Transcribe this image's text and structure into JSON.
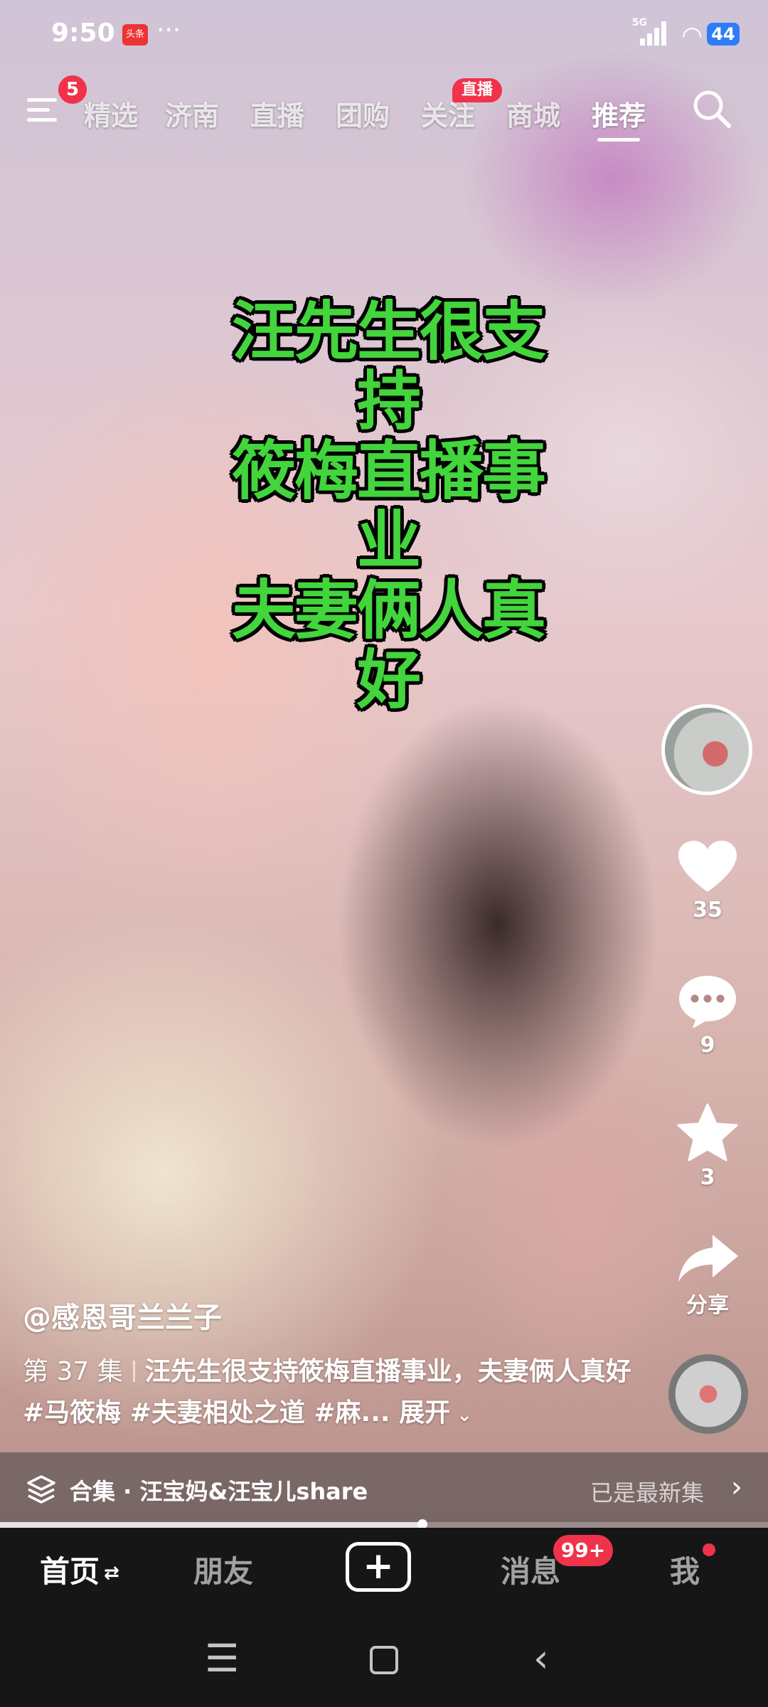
{
  "status_bar": {
    "time": "9:50",
    "news_badge": "头条",
    "more": "···",
    "network": "5G",
    "battery": "44"
  },
  "top_nav": {
    "menu_badge": "5",
    "tabs": [
      "精选",
      "济南",
      "直播",
      "团购",
      "关注",
      "商城",
      "推荐"
    ],
    "active_tab": "推荐",
    "live_badge": "直播",
    "icons": {
      "menu": "menu-icon",
      "search": "search-icon"
    }
  },
  "video": {
    "caption_lines": [
      "汪先生很支持",
      "筱梅直播事业",
      "夫妻俩人真好"
    ]
  },
  "right_rail": {
    "like_count": "35",
    "comment_count": "9",
    "favorite_count": "3",
    "share_label": "分享"
  },
  "info": {
    "author": "@感恩哥兰兰子",
    "episode": "第 37 集",
    "desc_text": "汪先生很支持筱梅直播事业，夫妻俩人真好 #马筱梅 #夫妻相处之道 #麻...",
    "expand_label": "展开"
  },
  "collection": {
    "label": "合集 · 汪宝妈&汪宝儿share",
    "status": "已是最新集"
  },
  "playback": {
    "progress": 0.55
  },
  "bottom_tabs": {
    "home": "首页",
    "friends": "朋友",
    "publish": "+",
    "messages": "消息",
    "messages_badge": "99+",
    "me": "我"
  },
  "colors": {
    "accent_red": "#f0324b",
    "caption_green": "#43d53c",
    "battery_blue": "#2e7df7"
  }
}
